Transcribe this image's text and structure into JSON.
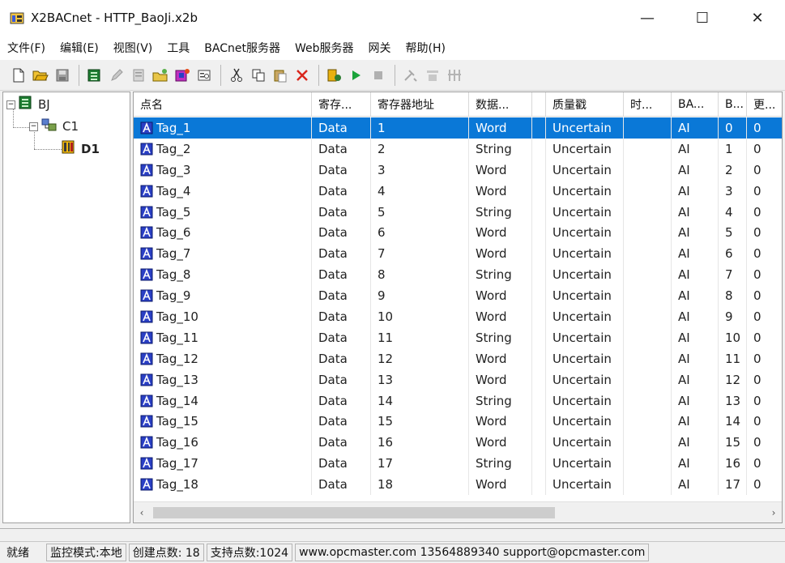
{
  "window": {
    "title": "X2BACnet - HTTP_BaoJi.x2b",
    "minimize": "—",
    "maximize": "☐",
    "close": "✕"
  },
  "menu": [
    "文件(F)",
    "编辑(E)",
    "视图(V)",
    "工具",
    "BACnet服务器",
    "Web服务器",
    "网关",
    "帮助(H)"
  ],
  "toolbar_icons": [
    "new-icon",
    "open-icon",
    "save-icon",
    "sep",
    "device-icon",
    "edit-icon",
    "register-icon",
    "add-folder-icon",
    "add-tag-icon",
    "properties-icon",
    "sep",
    "cut-icon",
    "copy-icon",
    "paste-icon",
    "delete-icon",
    "sep",
    "run-config-icon",
    "start-icon",
    "stop-icon",
    "sep",
    "tools-icon",
    "tools2-icon",
    "tools3-icon"
  ],
  "tree": {
    "root": "BJ",
    "channel": "C1",
    "device": "D1"
  },
  "grid": {
    "columns": [
      "点名",
      "寄存...",
      "寄存器地址",
      "数据...",
      "",
      "质量戳",
      "时...",
      "BA...",
      "B...",
      "更..."
    ],
    "rows": [
      [
        "Tag_1",
        "Data",
        "1",
        "Word",
        "",
        "Uncertain",
        "",
        "AI",
        "0",
        "0"
      ],
      [
        "Tag_2",
        "Data",
        "2",
        "String",
        "",
        "Uncertain",
        "",
        "AI",
        "1",
        "0"
      ],
      [
        "Tag_3",
        "Data",
        "3",
        "Word",
        "",
        "Uncertain",
        "",
        "AI",
        "2",
        "0"
      ],
      [
        "Tag_4",
        "Data",
        "4",
        "Word",
        "",
        "Uncertain",
        "",
        "AI",
        "3",
        "0"
      ],
      [
        "Tag_5",
        "Data",
        "5",
        "String",
        "",
        "Uncertain",
        "",
        "AI",
        "4",
        "0"
      ],
      [
        "Tag_6",
        "Data",
        "6",
        "Word",
        "",
        "Uncertain",
        "",
        "AI",
        "5",
        "0"
      ],
      [
        "Tag_7",
        "Data",
        "7",
        "Word",
        "",
        "Uncertain",
        "",
        "AI",
        "6",
        "0"
      ],
      [
        "Tag_8",
        "Data",
        "8",
        "String",
        "",
        "Uncertain",
        "",
        "AI",
        "7",
        "0"
      ],
      [
        "Tag_9",
        "Data",
        "9",
        "Word",
        "",
        "Uncertain",
        "",
        "AI",
        "8",
        "0"
      ],
      [
        "Tag_10",
        "Data",
        "10",
        "Word",
        "",
        "Uncertain",
        "",
        "AI",
        "9",
        "0"
      ],
      [
        "Tag_11",
        "Data",
        "11",
        "String",
        "",
        "Uncertain",
        "",
        "AI",
        "10",
        "0"
      ],
      [
        "Tag_12",
        "Data",
        "12",
        "Word",
        "",
        "Uncertain",
        "",
        "AI",
        "11",
        "0"
      ],
      [
        "Tag_13",
        "Data",
        "13",
        "Word",
        "",
        "Uncertain",
        "",
        "AI",
        "12",
        "0"
      ],
      [
        "Tag_14",
        "Data",
        "14",
        "String",
        "",
        "Uncertain",
        "",
        "AI",
        "13",
        "0"
      ],
      [
        "Tag_15",
        "Data",
        "15",
        "Word",
        "",
        "Uncertain",
        "",
        "AI",
        "14",
        "0"
      ],
      [
        "Tag_16",
        "Data",
        "16",
        "Word",
        "",
        "Uncertain",
        "",
        "AI",
        "15",
        "0"
      ],
      [
        "Tag_17",
        "Data",
        "17",
        "String",
        "",
        "Uncertain",
        "",
        "AI",
        "16",
        "0"
      ],
      [
        "Tag_18",
        "Data",
        "18",
        "Word",
        "",
        "Uncertain",
        "",
        "AI",
        "17",
        "0"
      ]
    ],
    "selected_row": 0
  },
  "status": {
    "state": "就绪",
    "mode": "监控模式:本地",
    "created": "创建点数: 18",
    "supported": "支持点数:1024",
    "contact": "www.opcmaster.com 13564889340 support@opcmaster.com"
  },
  "colors": {
    "selection": "#0a78d7",
    "tag_icon": "#2a3fc4"
  }
}
